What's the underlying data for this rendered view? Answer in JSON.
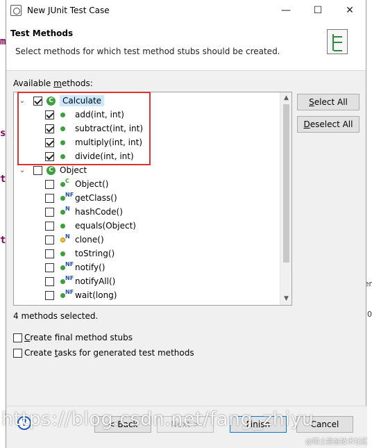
{
  "window": {
    "title": "New JUnit Test Case"
  },
  "header": {
    "title": "Test Methods",
    "description": "Select methods for which test method stubs should be created."
  },
  "available_label": {
    "pre": "Available ",
    "mnemonic": "m",
    "post": "ethods:"
  },
  "tree": {
    "nodes": [
      {
        "type": "class",
        "label": "Calculate",
        "checked": true,
        "expanded": true,
        "selected": true
      },
      {
        "type": "method",
        "label": "add(int, int)",
        "checked": true
      },
      {
        "type": "method",
        "label": "subtract(int, int)",
        "checked": true
      },
      {
        "type": "method",
        "label": "multiply(int, int)",
        "checked": true
      },
      {
        "type": "method",
        "label": "divide(int, int)",
        "checked": true
      },
      {
        "type": "class",
        "label": "Object",
        "checked": false,
        "expanded": true
      },
      {
        "type": "method",
        "label": "Object()",
        "checked": false,
        "badge": "C"
      },
      {
        "type": "method",
        "label": "getClass()",
        "checked": false,
        "badge": "NF"
      },
      {
        "type": "method",
        "label": "hashCode()",
        "checked": false,
        "badge": "N"
      },
      {
        "type": "method",
        "label": "equals(Object)",
        "checked": false
      },
      {
        "type": "method",
        "label": "clone()",
        "checked": false,
        "badge": "N",
        "protected": true
      },
      {
        "type": "method",
        "label": "toString()",
        "checked": false
      },
      {
        "type": "method",
        "label": "notify()",
        "checked": false,
        "badge": "NF"
      },
      {
        "type": "method",
        "label": "notifyAll()",
        "checked": false,
        "badge": "NF"
      },
      {
        "type": "method",
        "label": "wait(long)",
        "checked": false,
        "badge": "NF"
      }
    ]
  },
  "buttons": {
    "select_all": {
      "mnemonic": "S",
      "rest": "elect All"
    },
    "deselect_all": {
      "mnemonic": "D",
      "rest": "eselect All"
    },
    "back": "< Back",
    "next": "Next >",
    "finish": "Finish",
    "cancel": "Cancel"
  },
  "status": "4 methods selected.",
  "options": {
    "final_stubs": {
      "mnemonic": "C",
      "rest": "reate final method stubs",
      "checked": false
    },
    "tasks": {
      "pre": "Create ",
      "mnemonic": "t",
      "post": "asks for generated test methods",
      "checked": false
    }
  },
  "watermark": "https://blog.csdn.net/fang_zhiyu",
  "watermark_small": "@稀土掘金技术社区",
  "background_fragments": {
    "left": [
      "m",
      "s",
      "t",
      "t"
    ],
    "right": [
      "er",
      ":0"
    ]
  }
}
